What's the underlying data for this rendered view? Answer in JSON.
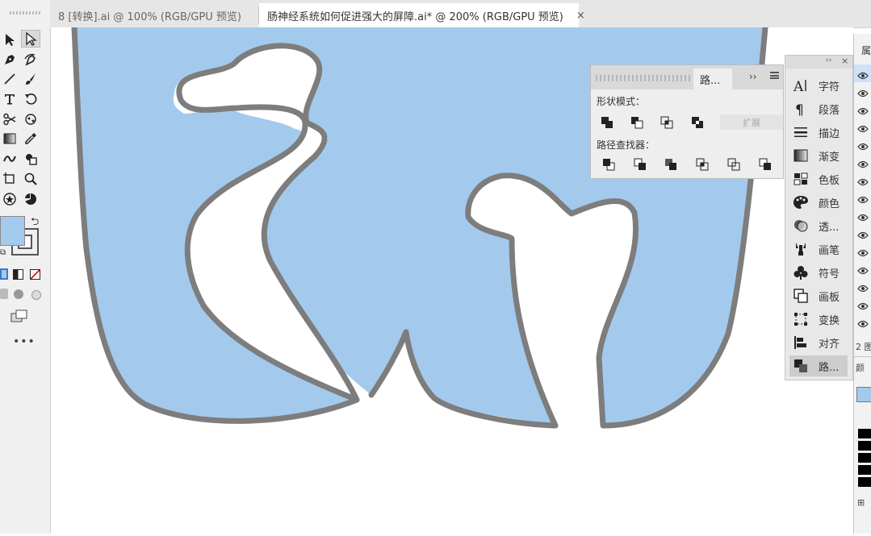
{
  "tabs": [
    {
      "label": "8 [转换].ai @ 100% (RGB/GPU 预览)",
      "active": false
    },
    {
      "label": "肠神经系统如何促进强大的屏障.ai* @ 200% (RGB/GPU 预览)",
      "active": true
    }
  ],
  "tab_close_glyph": "×",
  "pathfinder": {
    "tab_label": "路...",
    "chevron": "››",
    "shape_modes_label": "形状模式：",
    "pathfinders_label": "路径查找器：",
    "expand_label": "扩展"
  },
  "dock": {
    "top_chevron": "››",
    "top_close": "×",
    "items": [
      {
        "icon": "character-icon",
        "label": "字符"
      },
      {
        "icon": "paragraph-icon",
        "label": "段落"
      },
      {
        "icon": "stroke-icon",
        "label": "描边"
      },
      {
        "icon": "gradient-icon",
        "label": "渐变"
      },
      {
        "icon": "swatches-icon",
        "label": "色板"
      },
      {
        "icon": "color-icon",
        "label": "颜色"
      },
      {
        "icon": "transparency-icon",
        "label": "透..."
      },
      {
        "icon": "brush-icon",
        "label": "画笔"
      },
      {
        "icon": "symbol-icon",
        "label": "符号"
      },
      {
        "icon": "artboard-icon",
        "label": "画板"
      },
      {
        "icon": "transform-icon",
        "label": "变换"
      },
      {
        "icon": "align-icon",
        "label": "对齐"
      },
      {
        "icon": "pathfinder-icon",
        "label": "路..."
      }
    ]
  },
  "right_panel": {
    "title": "属",
    "count_label": "2 图",
    "bottom_label": "颜"
  },
  "colors": {
    "fill": "#a3caed",
    "stroke": "#7d7d7d",
    "fill_swatch": "#a3caed"
  }
}
